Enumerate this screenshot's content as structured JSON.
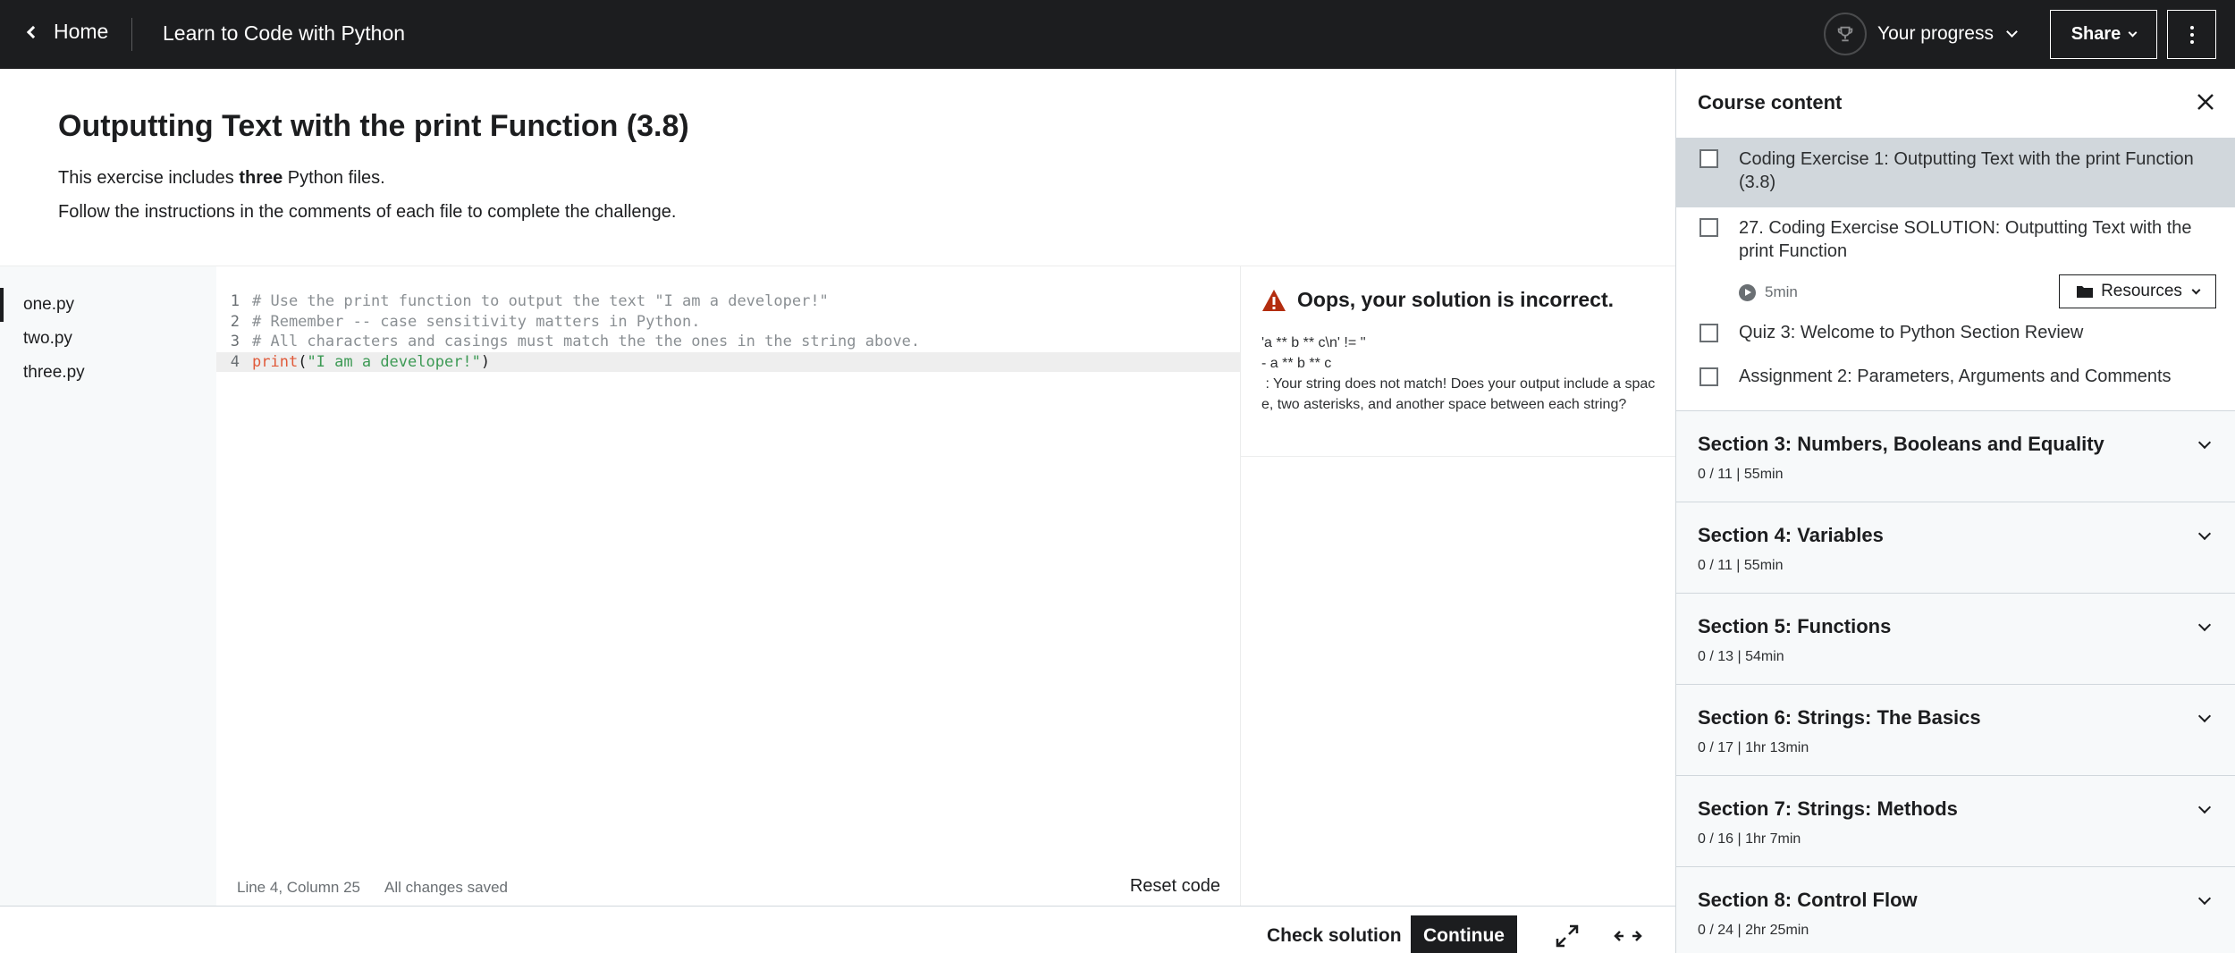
{
  "topbar": {
    "home_label": "Home",
    "course_title": "Learn to Code with Python",
    "progress_label": "Your progress",
    "share_label": "Share"
  },
  "exercise": {
    "title": "Outputting Text with the print Function (3.8)",
    "desc_prefix": "This exercise includes ",
    "desc_bold": "three",
    "desc_suffix": " Python files.",
    "desc_line2": "Follow the instructions in the comments of each file to complete the challenge."
  },
  "files": [
    "one.py",
    "two.py",
    "three.py"
  ],
  "code": {
    "lines": [
      {
        "n": "1",
        "text": "# Use the print function to output the text \"I am a developer!\""
      },
      {
        "n": "2",
        "text": "# Remember -- case sensitivity matters in Python."
      },
      {
        "n": "3",
        "text": "# All characters and casings must match the the ones in the string above."
      },
      {
        "n": "4",
        "kw": "print",
        "open": "(",
        "str": "\"I am a developer!\"",
        "close": ")"
      }
    ]
  },
  "status": {
    "position": "Line 4, Column 25",
    "saved": "All changes saved",
    "reset_label": "Reset code"
  },
  "result": {
    "heading": "Oops, your solution is incorrect.",
    "line1": "'a ** b ** c\\n' != ''",
    "line2": "- a ** b ** c",
    "line3": " : Your string does not match! Does your output include a space, two asterisks, and another space between each string?"
  },
  "bottom": {
    "check_label": "Check solution",
    "continue_label": "Continue"
  },
  "sidebar": {
    "title": "Course content",
    "lessons": [
      {
        "title": "Coding Exercise 1: Outputting Text with the print Function (3.8)"
      },
      {
        "title": "27. Coding Exercise SOLUTION: Outputting Text with the print Function",
        "duration": "5min",
        "resources_label": "Resources"
      },
      {
        "title": "Quiz 3: Welcome to Python Section Review"
      },
      {
        "title": "Assignment 2: Parameters, Arguments and Comments"
      }
    ],
    "sections": [
      {
        "title": "Section 3: Numbers, Booleans and Equality",
        "meta": "0 / 11 | 55min"
      },
      {
        "title": "Section 4: Variables",
        "meta": "0 / 11 | 55min"
      },
      {
        "title": "Section 5: Functions",
        "meta": "0 / 13 | 54min"
      },
      {
        "title": "Section 6: Strings: The Basics",
        "meta": "0 / 17 | 1hr 13min"
      },
      {
        "title": "Section 7: Strings: Methods",
        "meta": "0 / 16 | 1hr 7min"
      },
      {
        "title": "Section 8: Control Flow",
        "meta": "0 / 24 | 2hr 25min"
      }
    ]
  },
  "colors": {
    "topbar_bg": "#1c1d1f",
    "warning": "#b32d0f",
    "active_lesson_bg": "#d1d7dc"
  }
}
